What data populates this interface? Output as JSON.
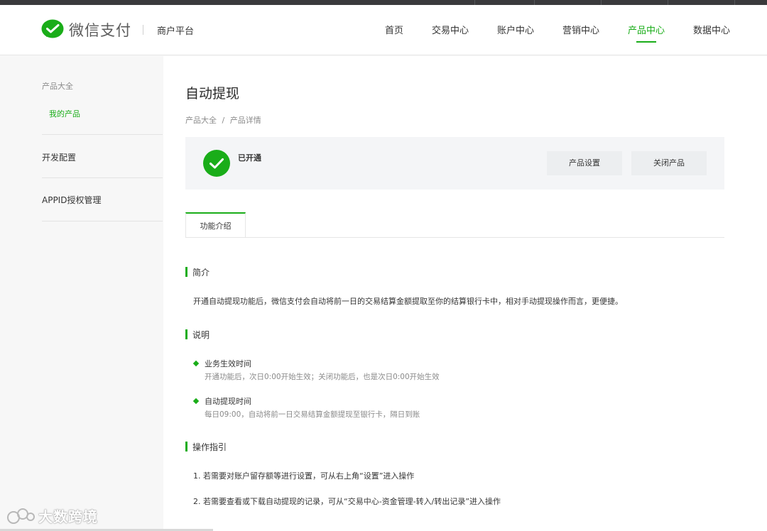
{
  "header": {
    "brand": "微信支付",
    "platform": "商户平台",
    "nav": [
      "首页",
      "交易中心",
      "账户中心",
      "营销中心",
      "产品中心",
      "数据中心"
    ],
    "active_nav": "产品中心",
    "accent_color": "#1aad19"
  },
  "sidebar": {
    "group_title": "产品大全",
    "active_item": "我的产品",
    "items": [
      "开发配置",
      "APPID授权管理"
    ]
  },
  "main": {
    "title": "自动提现",
    "breadcrumb": [
      "产品大全",
      "/",
      "产品详情"
    ],
    "status": "已开通",
    "buttons": [
      "产品设置",
      "关闭产品"
    ],
    "tab": "功能介绍",
    "intro_heading": "简介",
    "intro_text": "开通自动提现功能后，微信支付会自动将前一日的交易结算金额提取至你的结算银行卡中，相对手动提现操作而言，更便捷。",
    "desc_heading": "说明",
    "desc_items": [
      {
        "title": "业务生效时间",
        "text": "开通功能后，次日0:00开始生效；关闭功能后，也是次日0:00开始生效"
      },
      {
        "title": "自动提现时间",
        "text": "每日09:00，自动将前一日交易结算金额提现至银行卡，隔日到账"
      }
    ],
    "guide_heading": "操作指引",
    "guide_items": [
      "1. 若需要对账户留存额等进行设置，可从右上角“设置”进入操作",
      "2. 若需要查看或下载自动提现的记录，可从“交易中心-资金管理-转入/转出记录”进入操作"
    ]
  },
  "watermark": "大数跨境"
}
